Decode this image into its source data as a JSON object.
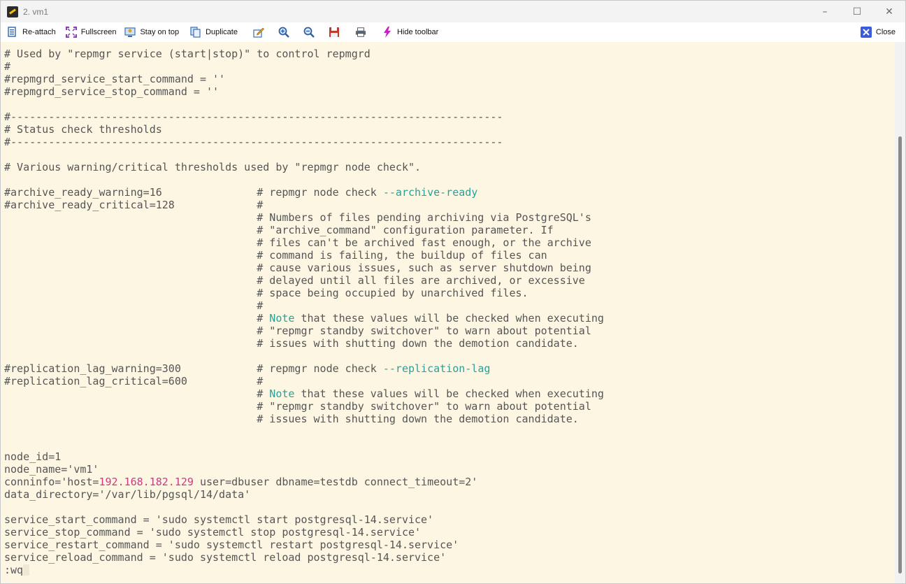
{
  "window": {
    "title": "2. vm1",
    "icon": "mobaxterm-icon",
    "controls": {
      "minimize": "–",
      "maximize": "☐",
      "close": "✕"
    }
  },
  "toolbar": {
    "reattach": "Re-attach",
    "fullscreen": "Fullscreen",
    "stay_on_top": "Stay on top",
    "duplicate": "Duplicate",
    "hide_toolbar": "Hide toolbar",
    "close": "Close",
    "icons": [
      "reattach-icon",
      "fullscreen-icon",
      "stay-on-top-icon",
      "duplicate-icon",
      "edit-icon",
      "zoom-in-icon",
      "zoom-out-icon",
      "save-icon",
      "print-icon",
      "hide-toolbar-icon",
      "close-icon"
    ]
  },
  "terminal": {
    "lines": [
      [
        {
          "t": "# Used by \"repmgr service (start|stop)\" to control repmgrd"
        }
      ],
      [
        {
          "t": "#"
        }
      ],
      [
        {
          "t": "#repmgrd_service_start_command = ''"
        }
      ],
      [
        {
          "t": "#repmgrd_service_stop_command = ''"
        }
      ],
      [
        {
          "t": ""
        }
      ],
      [
        {
          "t": "#------------------------------------------------------------------------------"
        }
      ],
      [
        {
          "t": "# Status check thresholds"
        }
      ],
      [
        {
          "t": "#------------------------------------------------------------------------------"
        }
      ],
      [
        {
          "t": ""
        }
      ],
      [
        {
          "t": "# Various warning/critical thresholds used by \"repmgr node check\"."
        }
      ],
      [
        {
          "t": ""
        }
      ],
      [
        {
          "t": "#archive_ready_warning=16               # repmgr node check "
        },
        {
          "t": "--archive-ready",
          "c": "hl-green"
        }
      ],
      [
        {
          "t": "#archive_ready_critical=128             #"
        }
      ],
      [
        {
          "t": "                                        # Numbers of files pending archiving via PostgreSQL's"
        }
      ],
      [
        {
          "t": "                                        # \"archive_command\" configuration parameter. If"
        }
      ],
      [
        {
          "t": "                                        # files can't be archived fast enough, or the archive"
        }
      ],
      [
        {
          "t": "                                        # command is failing, the buildup of files can"
        }
      ],
      [
        {
          "t": "                                        # cause various issues, such as server shutdown being"
        }
      ],
      [
        {
          "t": "                                        # delayed until all files are archived, or excessive"
        }
      ],
      [
        {
          "t": "                                        # space being occupied by unarchived files."
        }
      ],
      [
        {
          "t": "                                        #"
        }
      ],
      [
        {
          "t": "                                        # "
        },
        {
          "t": "Note",
          "c": "hl-green"
        },
        {
          "t": " that these values will be checked when executing"
        }
      ],
      [
        {
          "t": "                                        # \"repmgr standby switchover\" to warn about potential"
        }
      ],
      [
        {
          "t": "                                        # issues with shutting down the demotion candidate."
        }
      ],
      [
        {
          "t": ""
        }
      ],
      [
        {
          "t": "#replication_lag_warning=300            # repmgr node check "
        },
        {
          "t": "--replication-lag",
          "c": "hl-green"
        }
      ],
      [
        {
          "t": "#replication_lag_critical=600           #"
        }
      ],
      [
        {
          "t": "                                        # "
        },
        {
          "t": "Note",
          "c": "hl-green"
        },
        {
          "t": " that these values will be checked when executing"
        }
      ],
      [
        {
          "t": "                                        # \"repmgr standby switchover\" to warn about potential"
        }
      ],
      [
        {
          "t": "                                        # issues with shutting down the demotion candidate."
        }
      ],
      [
        {
          "t": ""
        }
      ],
      [
        {
          "t": ""
        }
      ],
      [
        {
          "t": "node_id=1"
        }
      ],
      [
        {
          "t": "node_name='vm1'"
        }
      ],
      [
        {
          "t": "conninfo='host="
        },
        {
          "t": "192.168.182.129",
          "c": "hl-red"
        },
        {
          "t": " user=dbuser dbname=testdb connect_timeout=2'"
        }
      ],
      [
        {
          "t": "data_directory='/var/lib/pgsql/14/data'"
        }
      ],
      [
        {
          "t": ""
        }
      ],
      [
        {
          "t": "service_start_command = 'sudo systemctl start postgresql-14.service'"
        }
      ],
      [
        {
          "t": "service_stop_command = 'sudo systemctl stop postgresql-14.service'"
        }
      ],
      [
        {
          "t": "service_restart_command = 'sudo systemctl restart postgresql-14.service'"
        }
      ],
      [
        {
          "t": "service_reload_command = 'sudo systemctl reload postgresql-14.service'"
        }
      ]
    ],
    "command_line": ":wq"
  },
  "colors": {
    "terminal_bg": "#fdf6e3",
    "text": "#555555",
    "green": "#2aa198",
    "magenta": "#d33682"
  }
}
